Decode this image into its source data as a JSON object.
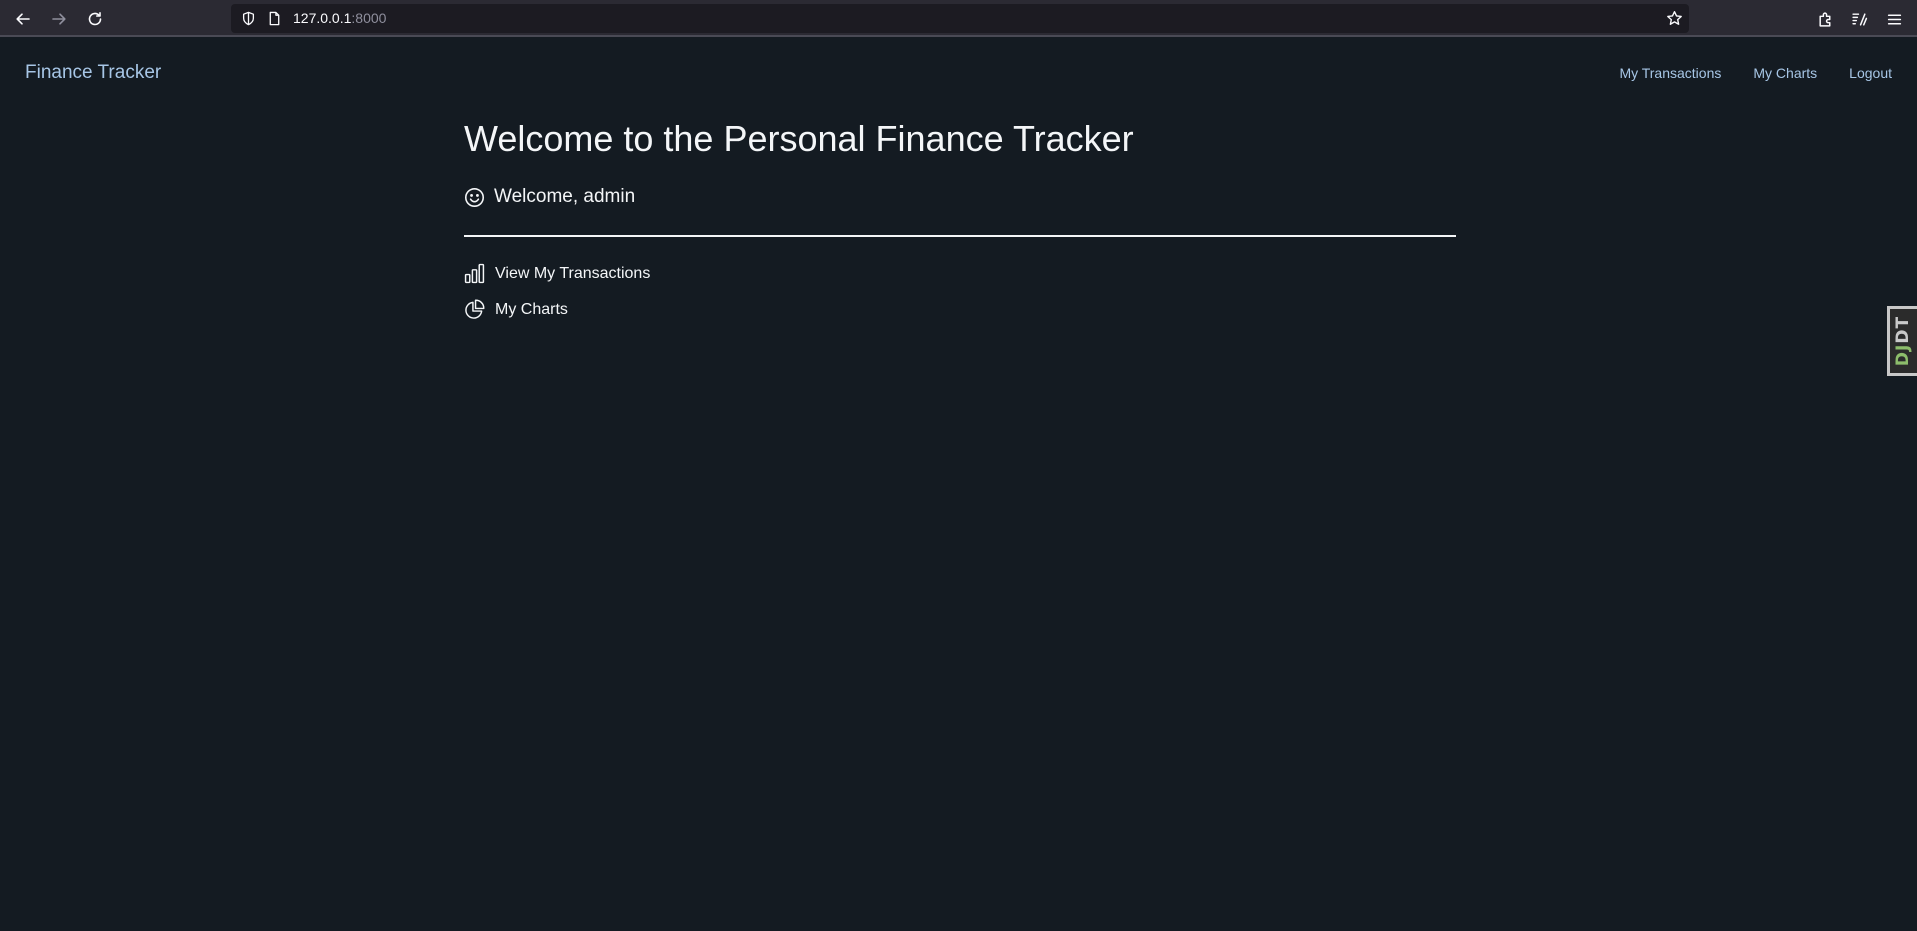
{
  "browser": {
    "url_host": "127.0.0.1",
    "url_port": ":8000",
    "icons": {
      "back": "back-arrow-icon",
      "forward": "forward-arrow-icon",
      "reload": "reload-icon",
      "shield": "shield-icon",
      "page": "page-icon",
      "bookmark": "star-icon",
      "extensions": "extensions-icon",
      "reader": "reader-view-icon",
      "menu": "hamburger-menu-icon"
    }
  },
  "navbar": {
    "brand": "Finance Tracker",
    "links": [
      {
        "label": "My Transactions"
      },
      {
        "label": "My Charts"
      },
      {
        "label": "Logout"
      }
    ]
  },
  "main": {
    "title": "Welcome to the Personal Finance Tracker",
    "welcome": "Welcome, admin",
    "links": [
      {
        "label": "View My Transactions",
        "icon": "bar-chart-icon"
      },
      {
        "label": "My Charts",
        "icon": "pie-chart-icon"
      }
    ]
  },
  "djdt": {
    "dj": "DJ",
    "dt": "DT"
  },
  "colors": {
    "page_bg": "#141b22",
    "nav_link": "#a7c6e6",
    "text": "#f4f6f8",
    "browser_bg": "#2b2a33",
    "url_bg": "#1c1b22"
  }
}
